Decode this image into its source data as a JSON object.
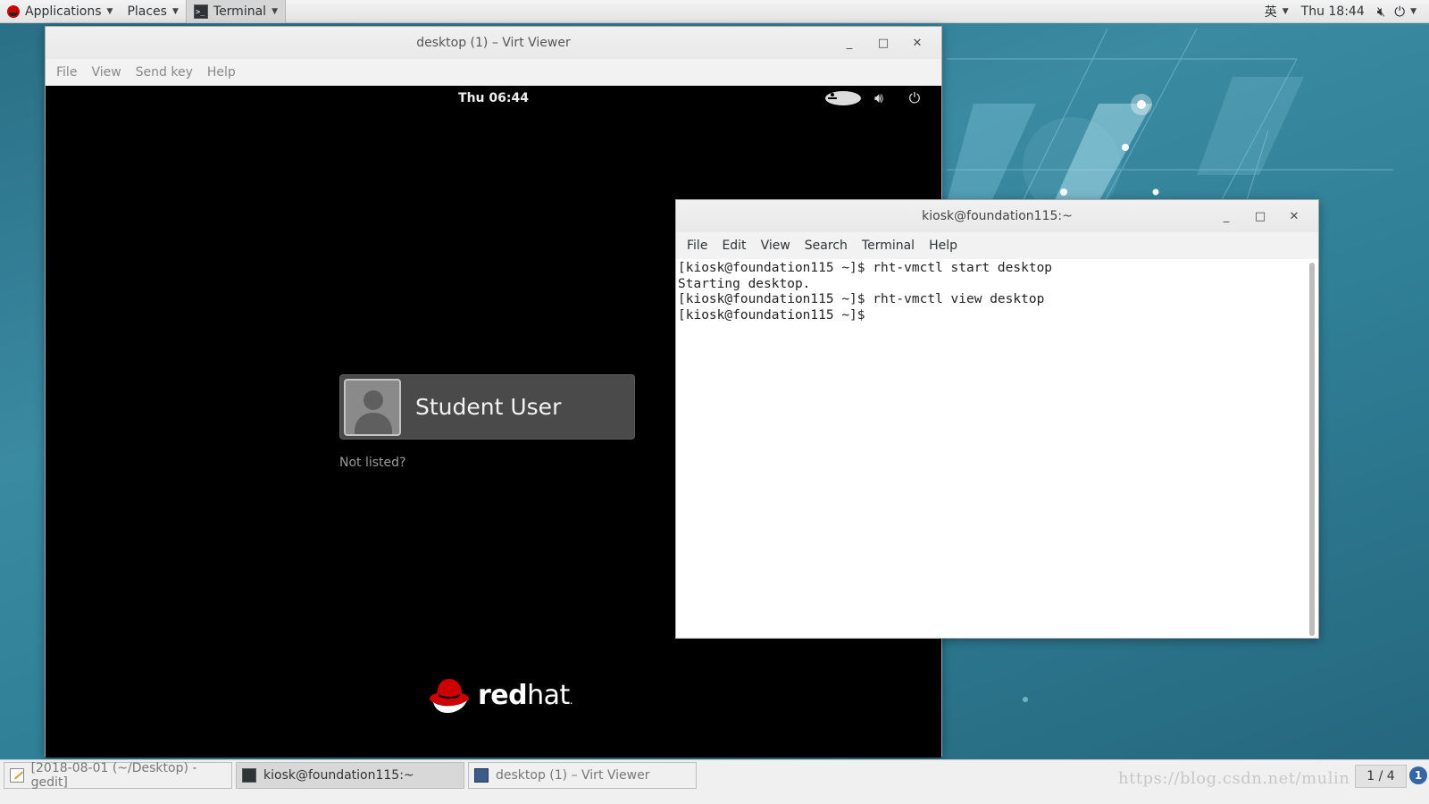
{
  "topbar": {
    "applications": "Applications",
    "places": "Places",
    "terminal": "Terminal",
    "input_method": "英",
    "clock": "Thu 18:44",
    "icons": [
      "volume-muted-icon",
      "power-icon"
    ]
  },
  "virt_viewer": {
    "title": "desktop (1) – Virt Viewer",
    "menu": [
      "File",
      "View",
      "Send key",
      "Help"
    ],
    "vm": {
      "clock": "Thu 06:44",
      "user_name": "Student User",
      "not_listed": "Not listed?",
      "logo_text_bold": "red",
      "logo_text": "hat",
      "logo_mark": "."
    }
  },
  "terminal": {
    "title": "kiosk@foundation115:~",
    "menu": [
      "File",
      "Edit",
      "View",
      "Search",
      "Terminal",
      "Help"
    ],
    "lines": [
      "[kiosk@foundation115 ~]$ rht-vmctl start desktop",
      "Starting desktop.",
      "[kiosk@foundation115 ~]$ rht-vmctl view desktop",
      "[kiosk@foundation115 ~]$ "
    ]
  },
  "taskbar": {
    "tasks": [
      "[2018-08-01 (~/Desktop) - gedit]",
      "kiosk@foundation115:~",
      "desktop (1) – Virt Viewer"
    ],
    "watermark": "https://blog.csdn.net/mulin",
    "workspace": "1 / 4",
    "notification_count": "1"
  },
  "colors": {
    "desktop": "#2f7c92",
    "vm_background": "#000000",
    "redhat_red": "#cc0000"
  }
}
